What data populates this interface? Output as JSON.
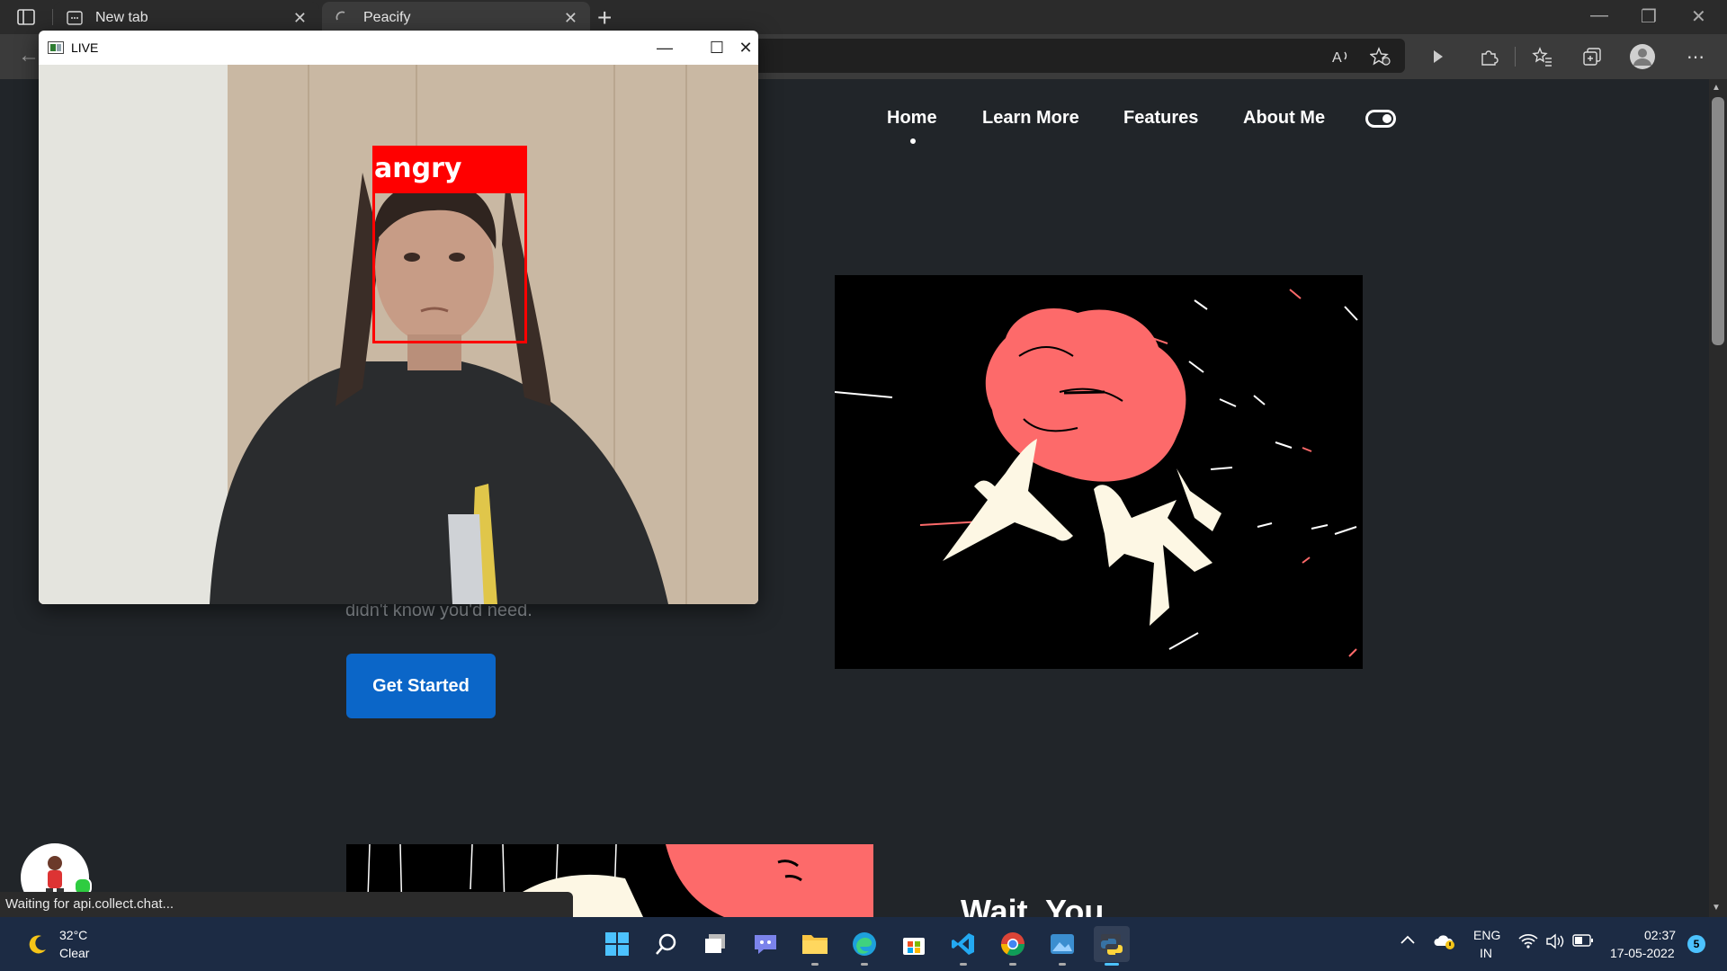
{
  "browser": {
    "tabs": [
      {
        "label": "New tab"
      },
      {
        "label": "Peacify"
      }
    ],
    "close_glyph": "✕",
    "new_tab_glyph": "+"
  },
  "site": {
    "nav": [
      "Home",
      "Learn More",
      "Features",
      "About Me"
    ],
    "tagline_fragment": "didn't know you'd need.",
    "cta_label": "Get Started",
    "section_heading_partial": "Wait, You"
  },
  "live_window": {
    "title": "LIVE",
    "emotion_label": "angry"
  },
  "status": {
    "text": "Waiting for api.collect.chat..."
  },
  "taskbar": {
    "weather_temp": "32°C",
    "weather_desc": "Clear",
    "lang_line1": "ENG",
    "lang_line2": "IN",
    "time": "02:37",
    "date": "17-05-2022",
    "notification_count": "5"
  },
  "colors": {
    "page_bg": "#212529",
    "accent_button": "#0b66c8",
    "detection_red": "#ff0000",
    "illustration_red": "#fd6a6a",
    "illustration_cream": "#fdf7e4"
  }
}
